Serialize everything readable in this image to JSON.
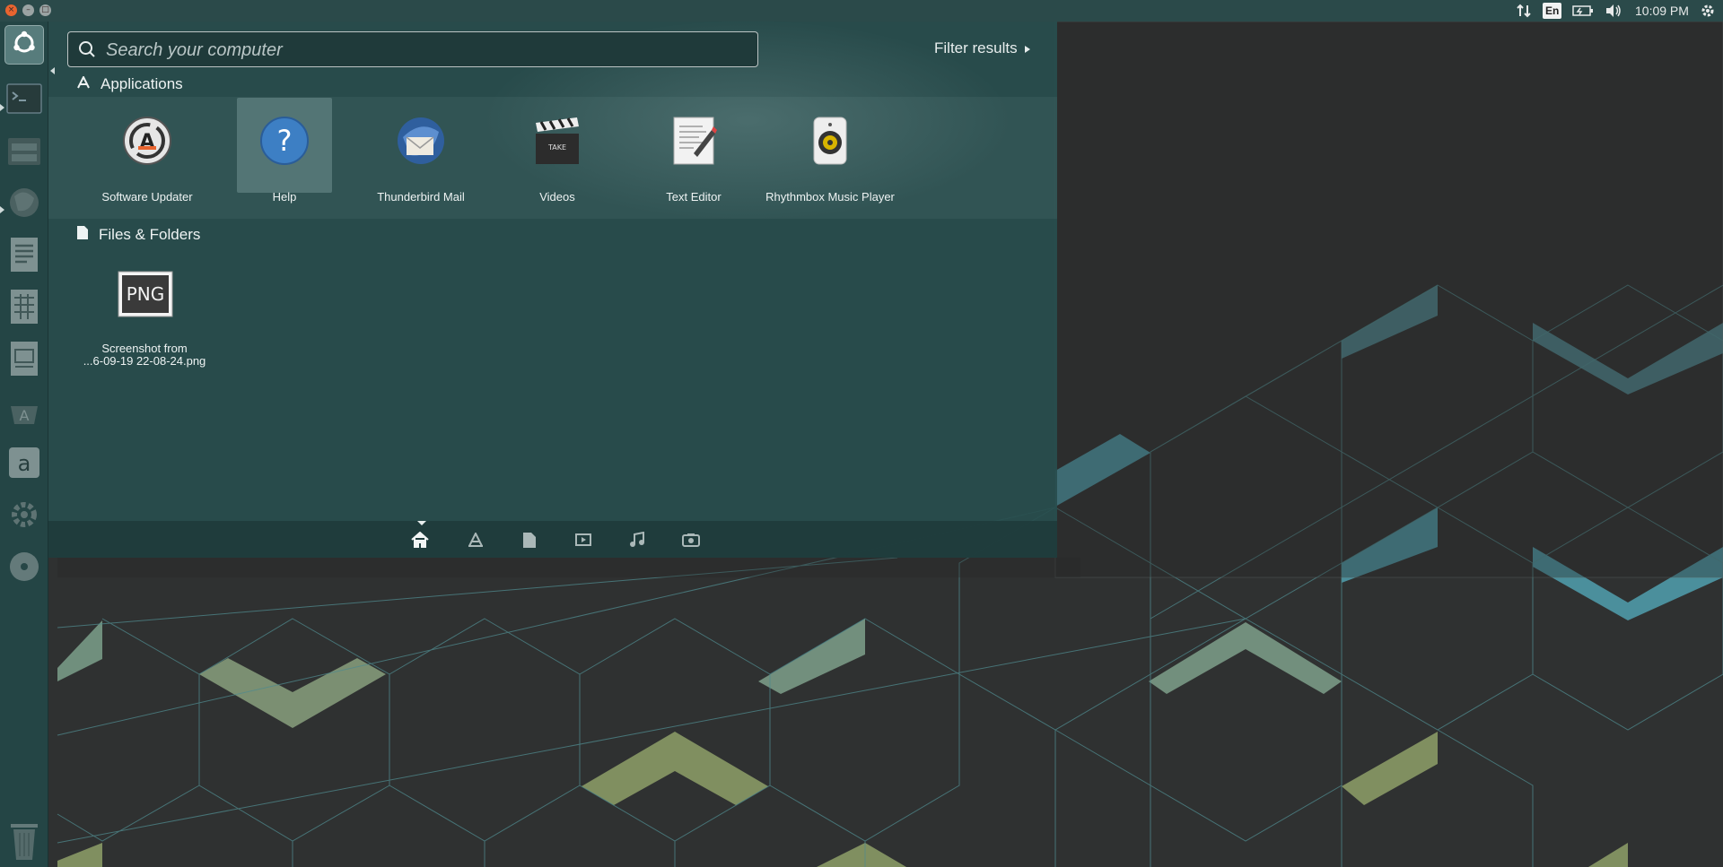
{
  "top_panel": {
    "lang": "En",
    "clock": "10:09 PM",
    "icons": [
      "network-transfer-icon",
      "keyboard-lang-icon",
      "battery-icon",
      "volume-icon",
      "settings-gear-icon"
    ]
  },
  "launcher": {
    "items": [
      {
        "name": "dash-home",
        "icon": "ubuntu-logo-icon"
      },
      {
        "name": "terminal",
        "icon": "terminal-icon"
      },
      {
        "name": "files",
        "icon": "file-manager-icon"
      },
      {
        "name": "firefox",
        "icon": "firefox-icon"
      },
      {
        "name": "writer",
        "icon": "writer-icon"
      },
      {
        "name": "calc",
        "icon": "calc-icon"
      },
      {
        "name": "impress",
        "icon": "impress-icon"
      },
      {
        "name": "software-center",
        "icon": "software-center-icon"
      },
      {
        "name": "amazon",
        "icon": "amazon-icon"
      },
      {
        "name": "system-settings",
        "icon": "settings-icon"
      },
      {
        "name": "dvd",
        "icon": "disc-icon"
      }
    ],
    "trash_icon": "trash-icon"
  },
  "dash": {
    "search": {
      "placeholder": "Search your computer",
      "value": ""
    },
    "filter_label": "Filter results",
    "sections": {
      "applications": "Applications",
      "files": "Files & Folders"
    },
    "apps": [
      {
        "label": "Software Updater",
        "icon": "software-updater-icon"
      },
      {
        "label": "Help",
        "icon": "help-icon"
      },
      {
        "label": "Thunderbird Mail",
        "icon": "thunderbird-icon"
      },
      {
        "label": "Videos",
        "icon": "videos-clapper-icon"
      },
      {
        "label": "Text Editor",
        "icon": "text-editor-icon"
      },
      {
        "label": "Rhythmbox Music Player",
        "icon": "rhythmbox-icon"
      }
    ],
    "files": [
      {
        "label_line1": "Screenshot from",
        "label_line2": "...6-09-19 22-08-24.png",
        "thumb_text": "PNG"
      }
    ],
    "categories": [
      "home-icon",
      "applications-icon",
      "files-icon",
      "video-icon",
      "music-icon",
      "photo-icon"
    ]
  },
  "colors": {
    "panel": "#2b4a4a",
    "launcher": "#244646",
    "dash": "#284e4e",
    "wallpaper": "#2f3131",
    "accent_teal": "#4f9a9e",
    "accent_olive": "#8a9a66"
  }
}
